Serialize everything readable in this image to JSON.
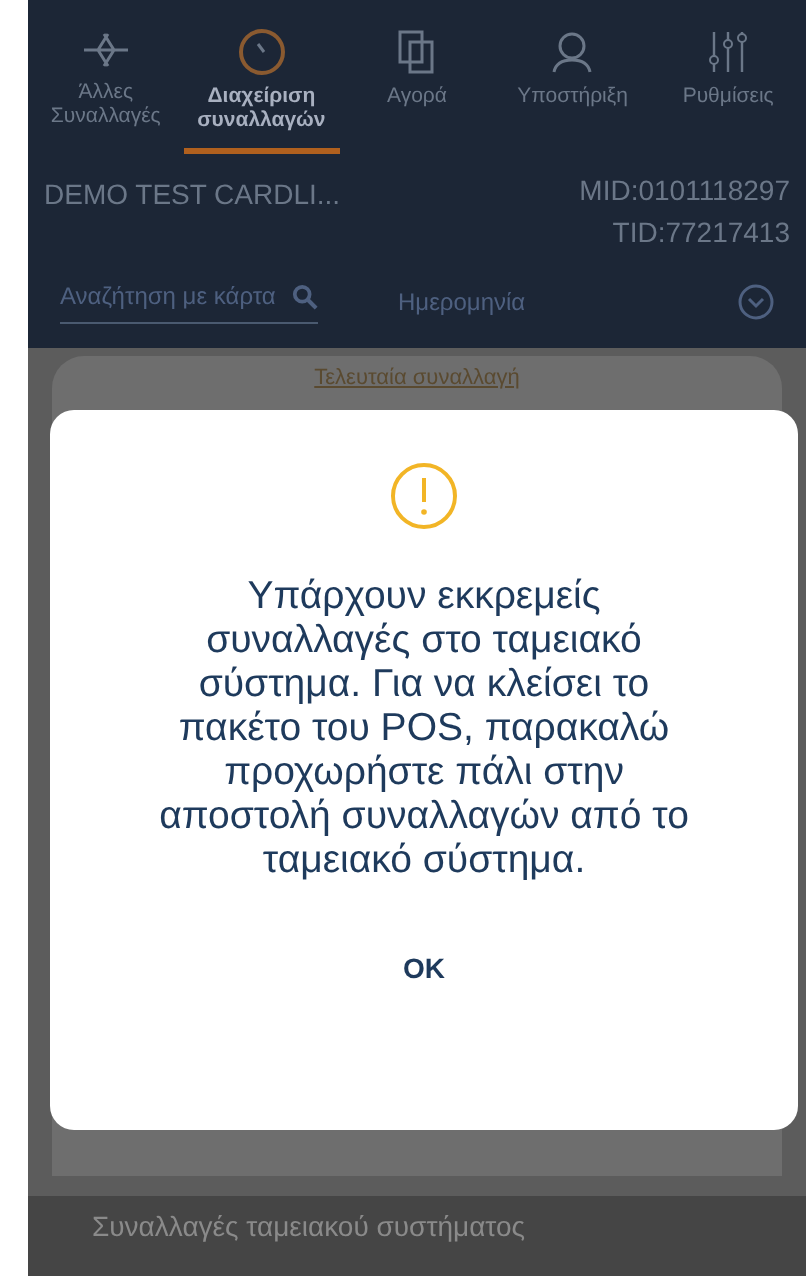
{
  "tabs": [
    {
      "label": "Άλλες Συναλλαγές",
      "selected": false
    },
    {
      "label": "Διαχείριση συναλλαγών",
      "selected": true
    },
    {
      "label": "Αγορά",
      "selected": false
    },
    {
      "label": "Υποστήριξη",
      "selected": false
    },
    {
      "label": "Ρυθμίσεις",
      "selected": false
    }
  ],
  "merchant": {
    "name": "DEMO TEST CARDLI...",
    "mid": "MID:0101118297",
    "tid": "TID:77217413"
  },
  "search": {
    "placeholder": "Αναζήτηση με κάρτα",
    "date_label": "Ημερομηνία"
  },
  "card_title": "Τελευταία συναλλαγή",
  "dialog": {
    "message": "Υπάρχουν εκκρεμείς συναλλαγές στο ταμειακό σύστημα. Για να κλείσει το πακέτο του POS, παρακαλώ προχωρήστε πάλι στην αποστολή συναλλαγών από το ταμειακό σύστημα.",
    "button": "OK"
  },
  "section_title": "Συναλλαγές ταμειακού συστήματος"
}
